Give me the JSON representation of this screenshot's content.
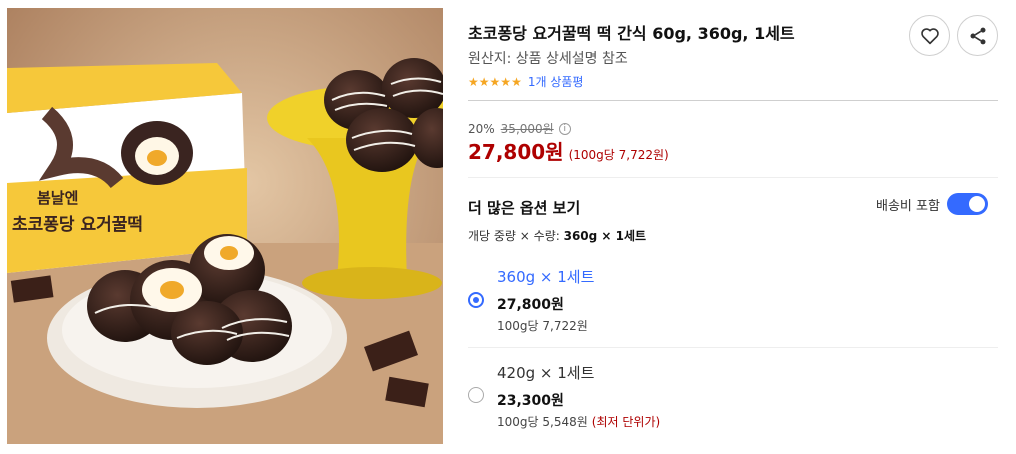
{
  "product": {
    "title": "초코퐁당 요거꿀떡 떡 간식 60g, 360g, 1세트",
    "origin": "원산지: 상품 상세설명 참조",
    "rating_stars": 5,
    "review_link": "1개 상품평",
    "box_brand": "봄날엔",
    "box_name": "초코퐁당 요거꿀떡"
  },
  "actions": {
    "heart_icon": "heart-outline",
    "share_icon": "share-nodes"
  },
  "pricing": {
    "discount_rate": "20%",
    "original_price": "35,000원",
    "sale_price": "27,800원",
    "unit_price": "(100g당 7,722원)"
  },
  "options": {
    "section_title": "더 많은 옵션 보기",
    "shipping_label": "배송비 포함",
    "shipping_included": true,
    "header_prefix": "개당 중량 × 수량: ",
    "header_value": "360g × 1세트",
    "items": [
      {
        "name": "360g × 1세트",
        "price": "27,800원",
        "unit_price": "100g당 7,722원",
        "note": "",
        "selected": true
      },
      {
        "name": "420g × 1세트",
        "price": "23,300원",
        "unit_price": "100g당 5,548원",
        "note": "(최저 단위가)",
        "selected": false
      }
    ]
  },
  "colors": {
    "accent_blue": "#346aff",
    "price_red": "#ae0000",
    "star_gold": "#f5a623"
  }
}
